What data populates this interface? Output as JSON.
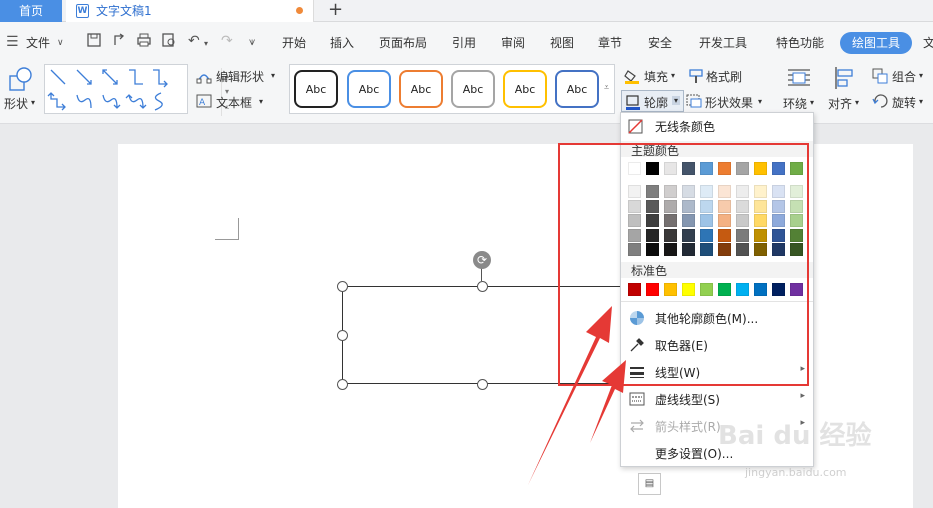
{
  "tabs": {
    "home": "首页",
    "doc_title": "文字文稿1",
    "doc_icon": "W",
    "plus": "+"
  },
  "menu": {
    "file": "文件",
    "items": [
      "开始",
      "插入",
      "页面布局",
      "引用",
      "审阅",
      "视图",
      "章节",
      "安全",
      "开发工具",
      "特色功能"
    ],
    "active": "绘图工具",
    "more": "文"
  },
  "ribbon": {
    "shape": "形状",
    "edit_shape": "编辑形状",
    "text_box": "文本框",
    "style_sample": "Abc",
    "fill": "填充",
    "format_brush": "格式刷",
    "outline": "轮廓",
    "shape_effect": "形状效果",
    "wrap": "环绕",
    "align": "对齐",
    "group": "组合",
    "rotate": "旋转"
  },
  "style_borders": [
    "#222222",
    "#4a8fe4",
    "#ed7d31",
    "#a5a5a5",
    "#ffc000",
    "#4472c4"
  ],
  "popup": {
    "no_line": "无线条颜色",
    "theme_colors": "主题颜色",
    "standard_colors": "标准色",
    "more_colors": "其他轮廓颜色(M)...",
    "eyedropper": "取色器(E)",
    "line_type": "线型(W)",
    "dash_type": "虚线线型(S)",
    "arrow_style": "箭头样式(R)",
    "more_settings": "更多设置(O)..."
  },
  "theme_top": [
    "#ffffff",
    "#000000",
    "#e7e6e6",
    "#44546a",
    "#5b9bd5",
    "#ed7d31",
    "#a5a5a5",
    "#ffc000",
    "#4472c4",
    "#70ad47"
  ],
  "theme_shades": [
    [
      "#f2f2f2",
      "#7f7f7f",
      "#d0cece",
      "#d6dce4",
      "#deebf6",
      "#fbe5d5",
      "#ededed",
      "#fff2cc",
      "#d9e2f3",
      "#e2efd9"
    ],
    [
      "#d8d8d8",
      "#595959",
      "#aeabab",
      "#adb9ca",
      "#bdd7ee",
      "#f7cbac",
      "#dbdbdb",
      "#fee599",
      "#b4c6e7",
      "#c5e0b3"
    ],
    [
      "#bfbfbf",
      "#3f3f3f",
      "#757070",
      "#8496b0",
      "#9dc3e6",
      "#f4b183",
      "#c9c9c9",
      "#ffd965",
      "#8eaadb",
      "#a8d08d"
    ],
    [
      "#a5a5a5",
      "#262626",
      "#3a3838",
      "#323f4f",
      "#2e75b5",
      "#c55a11",
      "#7b7b7b",
      "#bf9000",
      "#2f5496",
      "#538135"
    ],
    [
      "#7f7f7f",
      "#0c0c0c",
      "#171616",
      "#222a35",
      "#1e4e79",
      "#833c0b",
      "#525252",
      "#7f6000",
      "#1f3864",
      "#375623"
    ]
  ],
  "standard": [
    "#c00000",
    "#ff0000",
    "#ffc000",
    "#ffff00",
    "#92d050",
    "#00b050",
    "#00b0f0",
    "#0070c0",
    "#002060",
    "#7030a0"
  ],
  "watermark": {
    "brand": "Bai du 经验",
    "url": "jingyan.baidu.com"
  }
}
